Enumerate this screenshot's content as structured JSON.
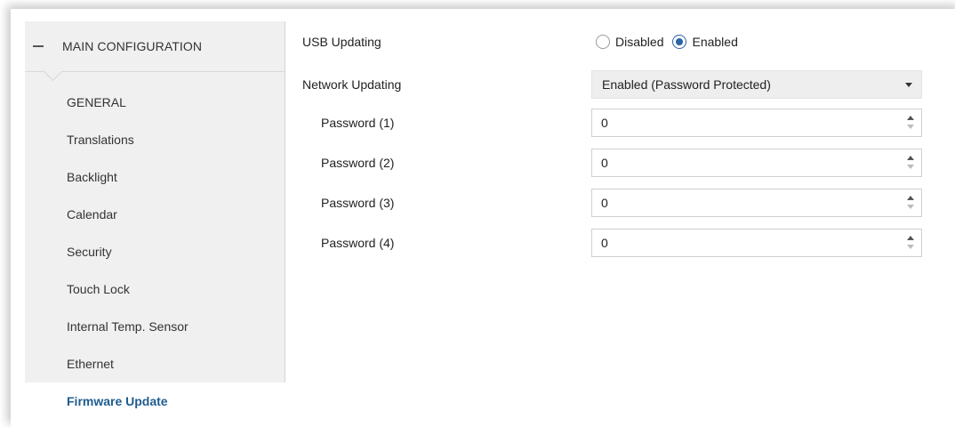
{
  "sidebar": {
    "section_label": "MAIN CONFIGURATION",
    "items": [
      {
        "label": "GENERAL"
      },
      {
        "label": "Translations"
      },
      {
        "label": "Backlight"
      },
      {
        "label": "Calendar"
      },
      {
        "label": "Security"
      },
      {
        "label": "Touch Lock"
      },
      {
        "label": "Internal Temp. Sensor"
      },
      {
        "label": "Ethernet"
      },
      {
        "label": "Firmware Update"
      }
    ],
    "active_item": "Firmware Update"
  },
  "main": {
    "usb_updating": {
      "label": "USB Updating",
      "options": [
        "Disabled",
        "Enabled"
      ],
      "selected": "Enabled"
    },
    "network_updating": {
      "label": "Network Updating",
      "value": "Enabled (Password Protected)"
    },
    "passwords": [
      {
        "label": "Password (1)",
        "value": "0"
      },
      {
        "label": "Password (2)",
        "value": "0"
      },
      {
        "label": "Password (3)",
        "value": "0"
      },
      {
        "label": "Password (4)",
        "value": "0"
      }
    ]
  },
  "colors": {
    "accent": "#2b63a8",
    "active_text": "#1f5c8f",
    "sidebar_bg": "#f0f0f0"
  },
  "icons": {
    "collapse": "minus-icon",
    "dropdown": "caret-down-icon",
    "spinner": "spinner-arrows-icon"
  }
}
